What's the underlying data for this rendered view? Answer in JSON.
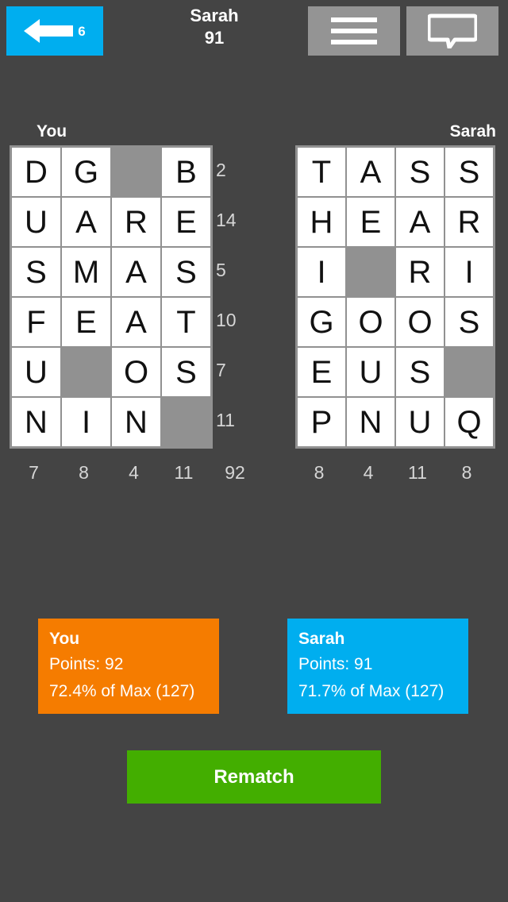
{
  "header": {
    "back_icon": "back-arrow-icon",
    "back_count": "6",
    "opponent_name": "Sarah",
    "opponent_score": "91",
    "menu_icon": "hamburger-menu-icon",
    "chat_icon": "chat-bubble-icon"
  },
  "boards": {
    "left": {
      "label": "You",
      "rows": [
        [
          "D",
          "G",
          "",
          "B"
        ],
        [
          "U",
          "A",
          "R",
          "E"
        ],
        [
          "S",
          "M",
          "A",
          "S"
        ],
        [
          "F",
          "E",
          "A",
          "T"
        ],
        [
          "U",
          "",
          "O",
          "S"
        ],
        [
          "N",
          "I",
          "N",
          ""
        ]
      ],
      "row_scores": [
        "2",
        "14",
        "5",
        "10",
        "7",
        "11"
      ],
      "col_scores": [
        "7",
        "8",
        "4",
        "11"
      ],
      "total": "92"
    },
    "right": {
      "label": "Sarah",
      "rows": [
        [
          "T",
          "A",
          "S",
          "S"
        ],
        [
          "H",
          "E",
          "A",
          "R"
        ],
        [
          "I",
          "",
          "R",
          "I"
        ],
        [
          "G",
          "O",
          "O",
          "S"
        ],
        [
          "E",
          "U",
          "S",
          ""
        ],
        [
          "P",
          "N",
          "U",
          "Q"
        ]
      ],
      "col_scores": [
        "8",
        "4",
        "11",
        "8"
      ]
    }
  },
  "results": [
    {
      "name": "You",
      "points": "Points: 92",
      "percent": "72.4% of Max (127)",
      "color": "#F57C00"
    },
    {
      "name": "Sarah",
      "points": "Points: 91",
      "percent": "71.7% of Max (127)",
      "color": "#00AEEF"
    }
  ],
  "rematch_label": "Rematch",
  "colors": {
    "background": "#444444",
    "grid_gray": "#919191",
    "accent_blue": "#00AEEF",
    "accent_orange": "#F57C00",
    "accent_green": "#43AE00"
  }
}
